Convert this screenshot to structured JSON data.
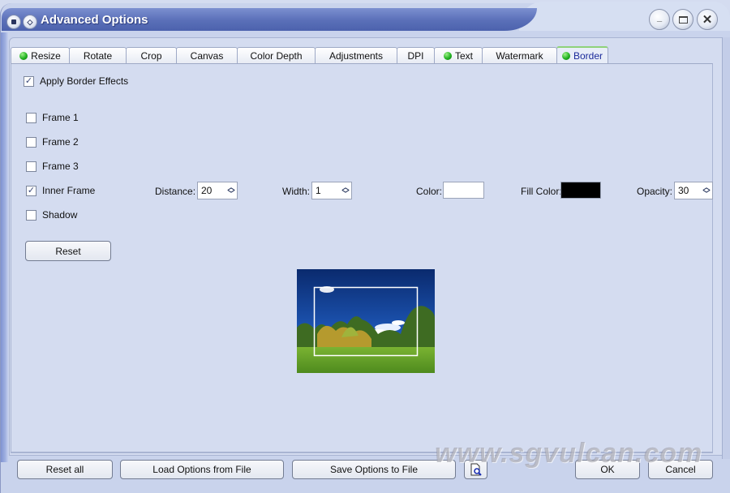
{
  "window": {
    "title": "Advanced Options",
    "controls": {
      "minimize": "_",
      "maximize": "□",
      "close": "✕"
    }
  },
  "tabs": [
    {
      "label": "Resize",
      "status_dot": true,
      "active": false
    },
    {
      "label": "Rotate",
      "status_dot": false,
      "active": false
    },
    {
      "label": "Crop",
      "status_dot": false,
      "active": false
    },
    {
      "label": "Canvas",
      "status_dot": false,
      "active": false
    },
    {
      "label": "Color Depth",
      "status_dot": false,
      "active": false
    },
    {
      "label": "Adjustments",
      "status_dot": false,
      "active": false
    },
    {
      "label": "DPI",
      "status_dot": false,
      "active": false
    },
    {
      "label": "Text",
      "status_dot": true,
      "active": false
    },
    {
      "label": "Watermark",
      "status_dot": false,
      "active": false
    },
    {
      "label": "Border",
      "status_dot": true,
      "active": true
    }
  ],
  "border": {
    "apply": {
      "label": "Apply Border Effects",
      "checked": true
    },
    "options": [
      {
        "label": "Frame 1",
        "checked": false
      },
      {
        "label": "Frame 2",
        "checked": false
      },
      {
        "label": "Frame 3",
        "checked": false
      },
      {
        "label": "Inner Frame",
        "checked": true
      },
      {
        "label": "Shadow",
        "checked": false
      }
    ],
    "inner_frame": {
      "distance_label": "Distance:",
      "distance": "20",
      "width_label": "Width:",
      "width": "1",
      "color_label": "Color:",
      "color": "#ffffff",
      "fill_color_label": "Fill Color:",
      "fill_color": "#000000",
      "opacity_label": "Opacity:",
      "opacity": "30"
    },
    "reset_label": "Reset",
    "check_glyph": "✓"
  },
  "footer": {
    "reset_all": "Reset all",
    "load_options": "Load Options from File",
    "save_options": "Save Options to File",
    "preview_icon": "preview-icon",
    "ok": "OK",
    "cancel": "Cancel"
  },
  "watermark_text": "www.sgvulcan.com",
  "spin_glyphs": {
    "up": "︿",
    "down": "﹀"
  }
}
